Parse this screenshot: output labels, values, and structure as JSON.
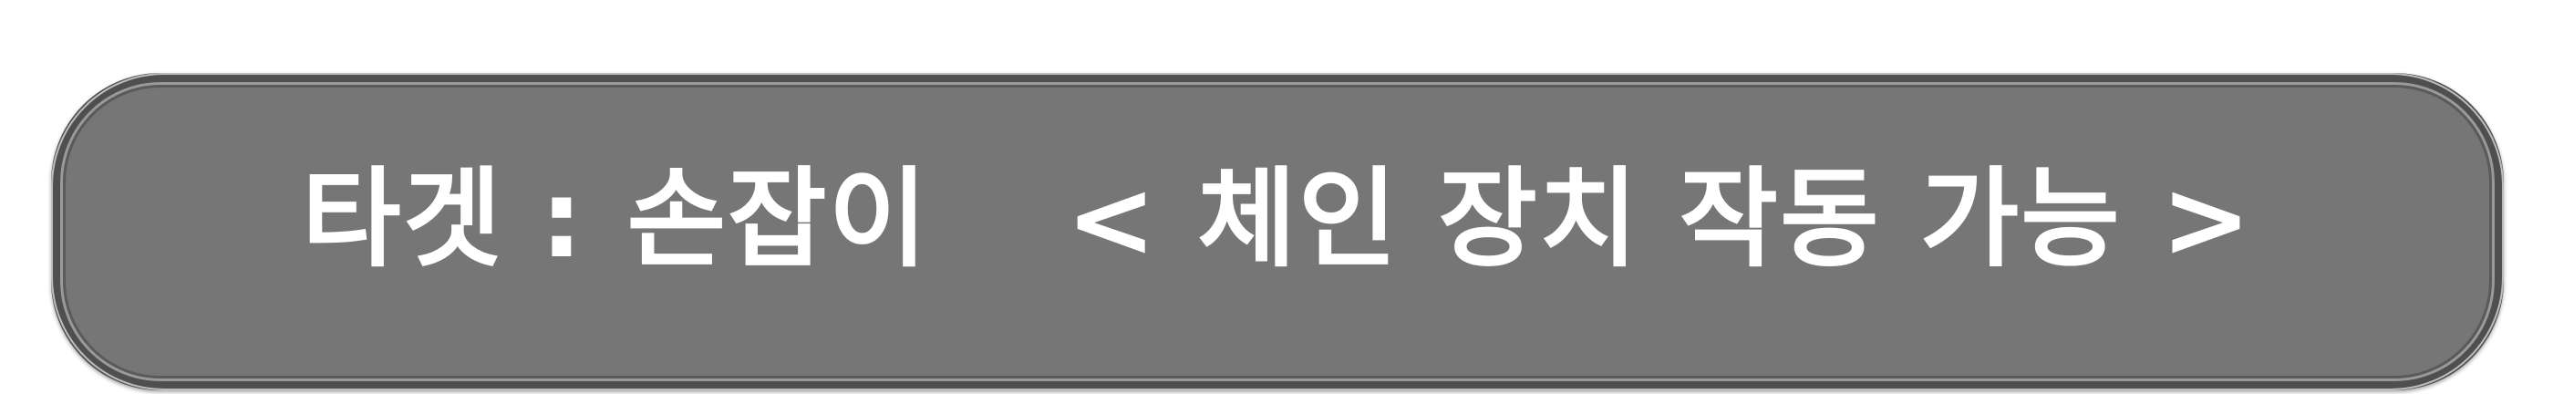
{
  "banner": {
    "label": "타겟",
    "separator": ":",
    "target_name": "손잡이",
    "status": "< 체인 장치 작동 가능 >"
  },
  "colors": {
    "banner_fill": "#767676",
    "banner_border": "#4f4f4f",
    "text": "#ffffff"
  }
}
